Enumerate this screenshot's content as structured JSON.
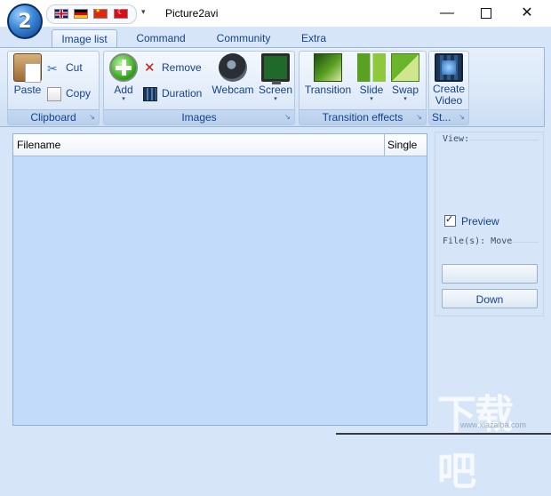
{
  "app": {
    "title": "Picture2avi",
    "logo_text": "2"
  },
  "quick_access": {
    "flags": [
      "uk-flag-icon",
      "germany-flag-icon",
      "china-flag-icon",
      "turkey-flag-icon"
    ],
    "customize_arrow": "▾"
  },
  "window_controls": {
    "minimize": "—",
    "close": "✕"
  },
  "tabs": [
    {
      "label": "Image list",
      "active": true
    },
    {
      "label": "Command",
      "active": false
    },
    {
      "label": "Community",
      "active": false
    },
    {
      "label": "Extra",
      "active": false
    }
  ],
  "ribbon": {
    "clipboard": {
      "label": "Clipboard",
      "paste": "Paste",
      "cut": "Cut",
      "copy": "Copy"
    },
    "images": {
      "label": "Images",
      "add": "Add",
      "remove": "Remove",
      "duration": "Duration",
      "webcam": "Webcam",
      "screen": "Screen"
    },
    "transition_effects": {
      "label": "Transition effects",
      "transition": "Transition",
      "slide": "Slide",
      "swap": "Swap"
    },
    "st": {
      "label": "St...",
      "create_line1": "Create",
      "create_line2": "Video"
    },
    "dropdown_arrow": "▾",
    "launcher": "↘"
  },
  "file_list": {
    "columns": [
      "Filename",
      "Single"
    ]
  },
  "side_panel": {
    "view_label": "View:",
    "preview_label": "Preview",
    "preview_checked": true,
    "files_move_label": "File(s): Move",
    "up_button": "",
    "down_button": "Down"
  },
  "watermark": {
    "text": "下载吧",
    "sub": "www.xiazaiba.com"
  },
  "colors": {
    "background": "#d6e6f8",
    "list_background": "#c2dbfa",
    "accent_text": "#15428b"
  }
}
